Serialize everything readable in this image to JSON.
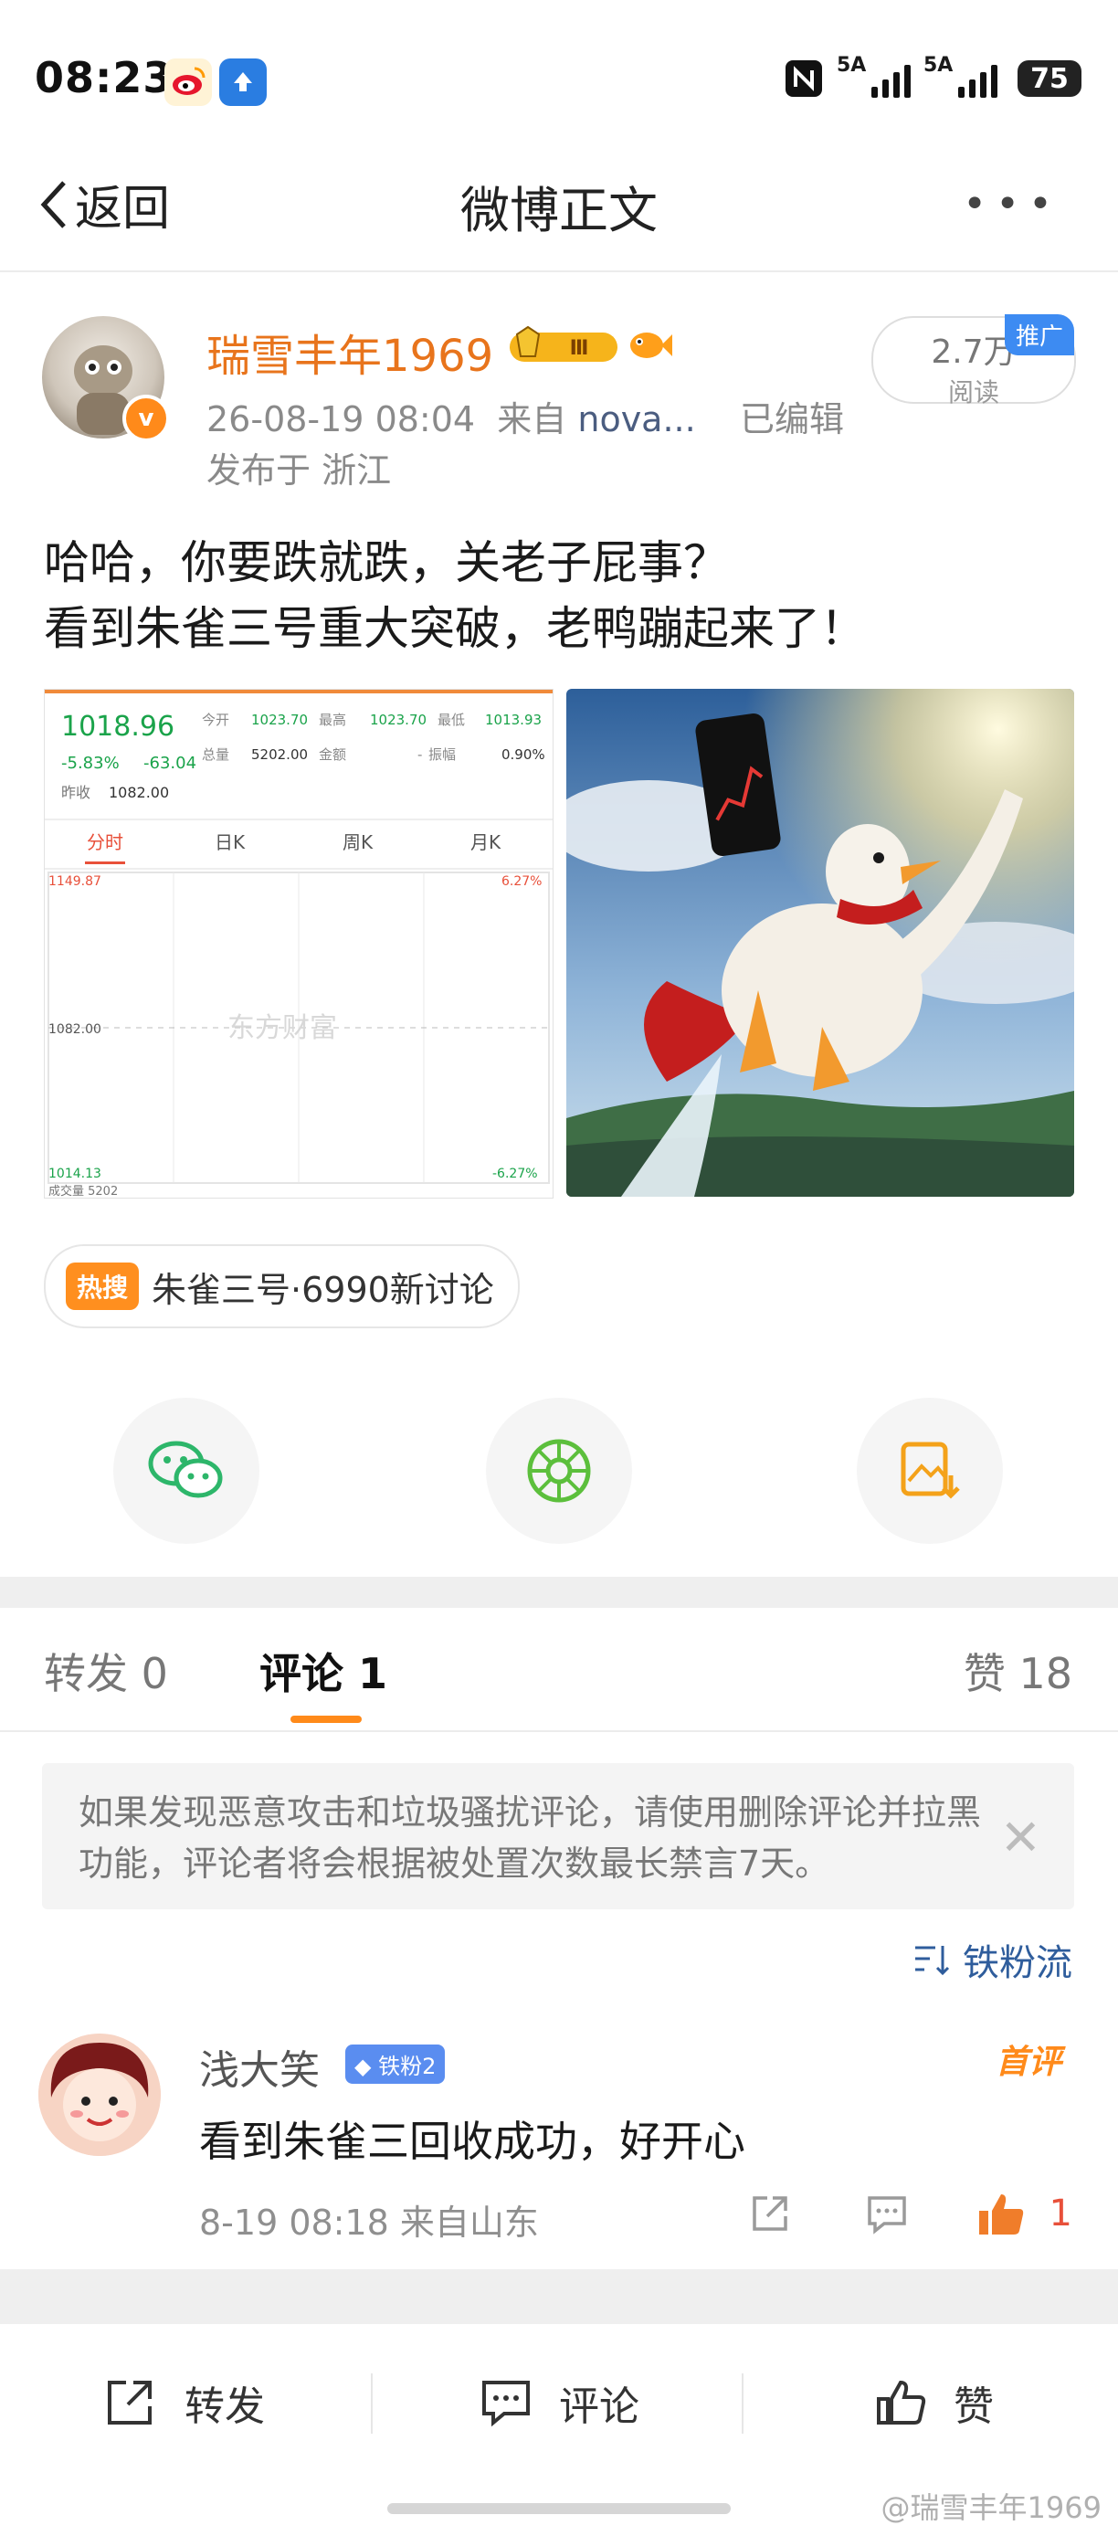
{
  "status_bar": {
    "time": "08:23",
    "network_1": "5A",
    "network_2": "5A",
    "battery": "75"
  },
  "header": {
    "back_label": "返回",
    "title": "微博正文",
    "more": "•••"
  },
  "post": {
    "author": "瑞雪丰年1969",
    "level_badge": "Ⅲ",
    "timestamp": "26-08-19 08:04",
    "source_prefix": "来自",
    "source": "nova...",
    "edited": "已编辑",
    "location": "发布于 浙江",
    "views": "2.7万",
    "views_label": "阅读",
    "promo_label": "推广",
    "text_line1": "哈哈，你要跌就跌，关老子屁事？",
    "text_line2": "看到朱雀三号重大突破，老鸭蹦起来了！",
    "stock": {
      "price": "1018.96",
      "change_pct": "-5.83%",
      "change": "-63.04",
      "prev_close_label": "昨收",
      "prev_close": "1082.00",
      "open_label": "今开",
      "open": "1023.70",
      "high_label": "最高",
      "high": "1023.70",
      "low_label": "最低",
      "low": "1013.93",
      "volume_label": "总量",
      "volume": "5202.00",
      "amount_label": "金额",
      "amplitude_label": "振幅",
      "amplitude": "0.90%",
      "tabs": [
        "分时",
        "日K",
        "周K",
        "月K"
      ],
      "axis_top": "1149.87",
      "axis_mid": "1082.00",
      "axis_bottom": "1014.13",
      "pct_top": "6.27%",
      "pct_bottom": "-6.27%",
      "watermark": "东方财富",
      "vol_label": "成交量 5202"
    },
    "hot_tag": "热搜",
    "hot_text": "朱雀三号·6990新讨论"
  },
  "share": {
    "wechat": "wechat",
    "moments": "moments",
    "save_image": "save-image"
  },
  "tabs": {
    "repost": "转发 0",
    "comment": "评论 1",
    "like": "赞 18"
  },
  "notice": "如果发现恶意攻击和垃圾骚扰评论，请使用删除评论并拉黑功能，评论者将会根据被处置次数最长禁言7天。",
  "sort_label": "铁粉流",
  "comment": {
    "user": "浅大笑",
    "fan_badge": "铁粉2",
    "first_label": "首评",
    "text": "看到朱雀三回收成功，好开心",
    "meta": "8-19 08:18 来自山东",
    "likes": "1"
  },
  "bottom_bar": {
    "repost": "转发",
    "comment": "评论",
    "like": "赞"
  },
  "watermark": "@瑞雪丰年1969",
  "colors": {
    "accent": "#ff8a1a",
    "username": "#e8741c",
    "link": "#2f5d9c",
    "like": "#e8503a",
    "fan_badge": "#5a8df0"
  }
}
